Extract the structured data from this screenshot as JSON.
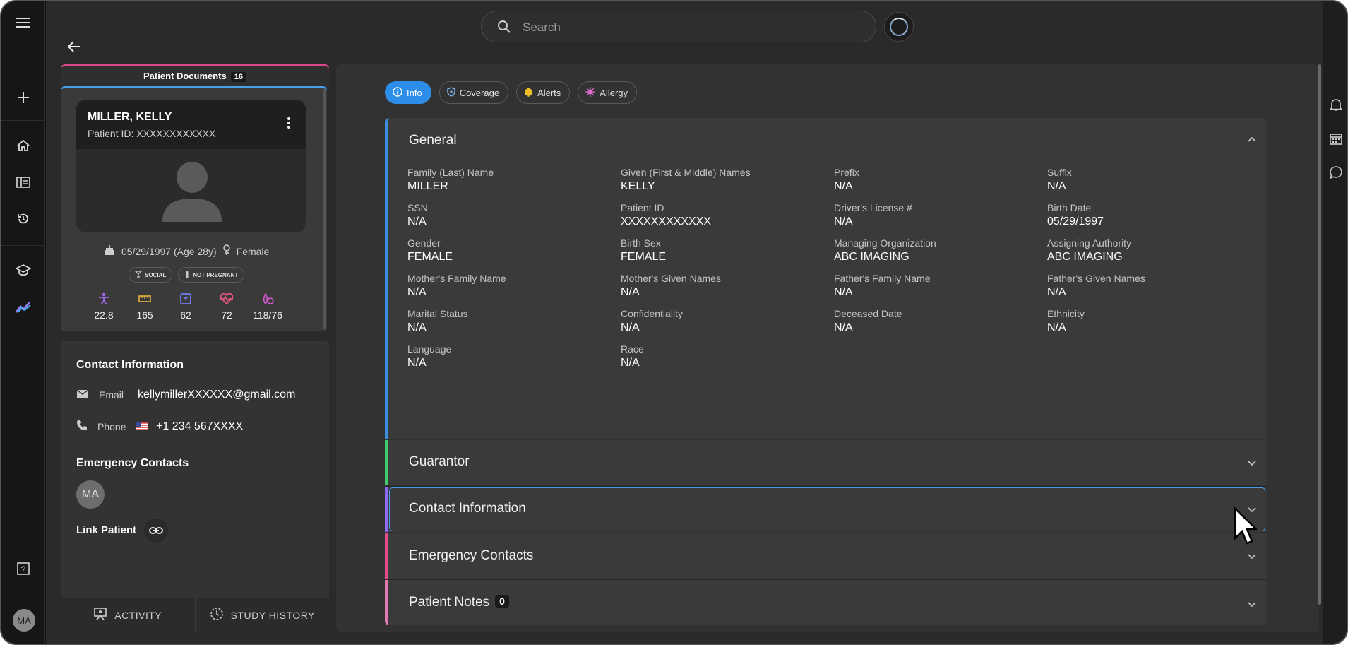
{
  "search": {
    "placeholder": "Search"
  },
  "user": {
    "initials": "MA"
  },
  "patient_documents": {
    "label": "Patient Documents",
    "count": "16"
  },
  "patient": {
    "name": "MILLER, KELLY",
    "patient_id_line": "Patient ID: XXXXXXXXXXXX",
    "dob_age": "05/29/1997 (Age 28y)",
    "sex": "Female",
    "chips": [
      "SOCIAL",
      "NOT PREGNANT"
    ],
    "vitals": [
      {
        "icon": "bmi-icon",
        "value": "22.8",
        "color": "#a66cf0"
      },
      {
        "icon": "ruler-icon",
        "value": "165",
        "color": "#e5b13c"
      },
      {
        "icon": "scale-icon",
        "value": "62",
        "color": "#6f7df0"
      },
      {
        "icon": "heart-rate-icon",
        "value": "72",
        "color": "#ef5a82"
      },
      {
        "icon": "blood-pressure-icon",
        "value": "118/76",
        "color": "#d45ad0"
      }
    ]
  },
  "contact": {
    "heading": "Contact Information",
    "email_label": "Email",
    "email_value": "kellymillerXXXXXX@gmail.com",
    "phone_label": "Phone",
    "phone_value": "+1 234 567XXXX"
  },
  "emergency": {
    "heading": "Emergency Contacts",
    "contact_initials": "MA"
  },
  "link_patient": {
    "label": "Link Patient"
  },
  "bottom_tabs": {
    "activity": "ACTIVITY",
    "study_history": "STUDY HISTORY"
  },
  "tabs": [
    {
      "label": "Info",
      "icon": "info-icon",
      "active": true
    },
    {
      "label": "Coverage",
      "icon": "shield-icon",
      "active": false
    },
    {
      "label": "Alerts",
      "icon": "bell-icon",
      "active": false
    },
    {
      "label": "Allergy",
      "icon": "allergy-icon",
      "active": false
    }
  ],
  "general": {
    "title": "General",
    "fields": [
      {
        "label": "Family (Last) Name",
        "value": "MILLER"
      },
      {
        "label": "Given (First & Middle) Names",
        "value": "KELLY"
      },
      {
        "label": "Prefix",
        "value": "N/A"
      },
      {
        "label": "Suffix",
        "value": "N/A"
      },
      {
        "label": "SSN",
        "value": "N/A"
      },
      {
        "label": "Patient ID",
        "value": "XXXXXXXXXXXX"
      },
      {
        "label": "Driver's License #",
        "value": "N/A"
      },
      {
        "label": "Birth Date",
        "value": "05/29/1997"
      },
      {
        "label": "Gender",
        "value": "FEMALE"
      },
      {
        "label": "Birth Sex",
        "value": "FEMALE"
      },
      {
        "label": "Managing Organization",
        "value": "ABC IMAGING"
      },
      {
        "label": "Assigning Authority",
        "value": "ABC IMAGING"
      },
      {
        "label": "Mother's Family Name",
        "value": "N/A"
      },
      {
        "label": "Mother's Given Names",
        "value": "N/A"
      },
      {
        "label": "Father's Family Name",
        "value": "N/A"
      },
      {
        "label": "Father's Given Names",
        "value": "N/A"
      },
      {
        "label": "Marital Status",
        "value": "N/A"
      },
      {
        "label": "Confidentiality",
        "value": "N/A"
      },
      {
        "label": "Deceased Date",
        "value": "N/A"
      },
      {
        "label": "Ethnicity",
        "value": "N/A"
      },
      {
        "label": "Language",
        "value": "N/A"
      },
      {
        "label": "Race",
        "value": "N/A"
      }
    ]
  },
  "sections": [
    {
      "title": "Guarantor",
      "accent": "#3ec96e"
    },
    {
      "title": "Contact Information",
      "accent": "#8a6cf0"
    },
    {
      "title": "Emergency Contacts",
      "accent": "#e24d8a"
    },
    {
      "title": "Patient Notes",
      "accent": "#e07ab0",
      "badge": "0"
    }
  ],
  "colors": {
    "accent_blue": "#2c8ee8",
    "general_bar": "#3a8fe0"
  }
}
